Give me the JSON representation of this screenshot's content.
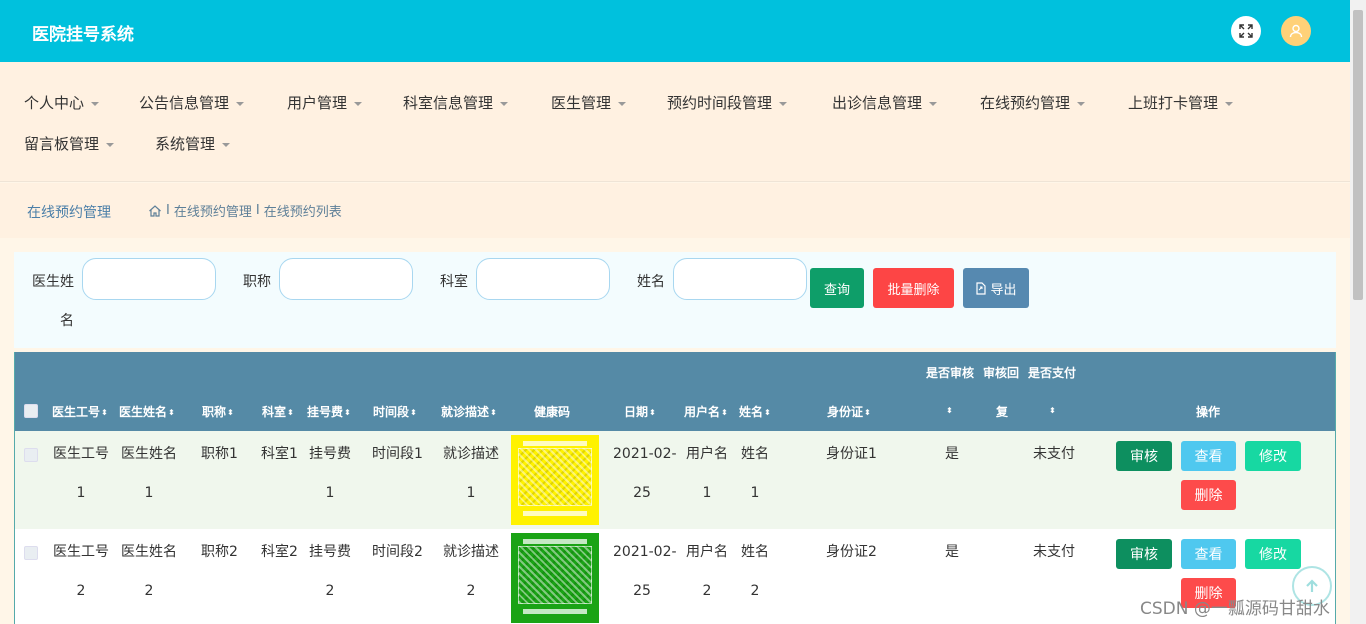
{
  "app": {
    "title": "医院挂号系统"
  },
  "menu": [
    {
      "label": "个人中心",
      "caret": true
    },
    {
      "label": "公告信息管理",
      "caret": true
    },
    {
      "label": "用户管理",
      "caret": true
    },
    {
      "label": "科室信息管理",
      "caret": true
    },
    {
      "label": "医生管理",
      "caret": true
    },
    {
      "label": "预约时间段管理",
      "caret": true
    },
    {
      "label": "出诊信息管理",
      "caret": true
    },
    {
      "label": "在线预约管理",
      "caret": true
    },
    {
      "label": "上班打卡管理",
      "caret": true
    },
    {
      "label": "留言板管理",
      "caret": true
    },
    {
      "label": "系统管理",
      "caret": true
    }
  ],
  "breadcrumb": {
    "title": "在线预约管理",
    "sep": "I",
    "item1": "在线预约管理",
    "item2": "在线预约列表"
  },
  "search": {
    "doctor_name_label_1": "医生姓",
    "doctor_name_label_2": "名",
    "title_label": "职称",
    "dept_label": "科室",
    "name_label": "姓名",
    "search_button": "查询",
    "bulk_delete_button": "批量删除",
    "export_button": "导出"
  },
  "table": {
    "headers": {
      "doctor_no": "医生工号",
      "doctor_name": "医生姓名",
      "title": "职称",
      "dept": "科室",
      "fee": "挂号费",
      "slot": "时间段",
      "desc": "就诊描述",
      "health_code": "健康码",
      "date": "日期",
      "username": "用户名",
      "name": "姓名",
      "id_card": "身份证",
      "audited": "是否审核",
      "reply_1": "审核回",
      "reply_2": "复",
      "paid": "是否支付",
      "ops": "操作"
    },
    "rows": [
      {
        "doctor_no_1": "医生工号",
        "doctor_no_2": "1",
        "doctor_name_1": "医生姓名",
        "doctor_name_2": "1",
        "title": "职称1",
        "dept": "科室1",
        "fee_1": "挂号费",
        "fee_2": "1",
        "slot": "时间段1",
        "desc_1": "就诊描述",
        "desc_2": "1",
        "date_1": "2021-02-",
        "date_2": "25",
        "username_1": "用户名",
        "username_2": "1",
        "name_1": "姓名",
        "name_2": "1",
        "id_card": "身份证1",
        "audited": "是",
        "paid": "未支付",
        "health_code_color": "#fff200"
      },
      {
        "doctor_no_1": "医生工号",
        "doctor_no_2": "2",
        "doctor_name_1": "医生姓名",
        "doctor_name_2": "2",
        "title": "职称2",
        "dept": "科室2",
        "fee_1": "挂号费",
        "fee_2": "2",
        "slot": "时间段2",
        "desc_1": "就诊描述",
        "desc_2": "2",
        "date_1": "2021-02-",
        "date_2": "25",
        "username_1": "用户名",
        "username_2": "2",
        "name_1": "姓名",
        "name_2": "2",
        "id_card": "身份证2",
        "audited": "是",
        "paid": "未支付",
        "health_code_color": "#1aa315"
      }
    ],
    "row_buttons": {
      "audit": "审核",
      "view": "查看",
      "edit": "修改",
      "delete": "删除"
    }
  },
  "watermark": "CSDN @一瓢源码甘甜水",
  "icons": [
    "fullscreen-icon",
    "user-icon",
    "home-icon",
    "export-icon",
    "back-to-top-icon"
  ],
  "colors": {
    "topbar": "#00c1dd",
    "menu_bg": "#fff1e1",
    "table_header": "#558aa6",
    "danger": "#fd4545",
    "primary_green": "#0e9e69"
  }
}
